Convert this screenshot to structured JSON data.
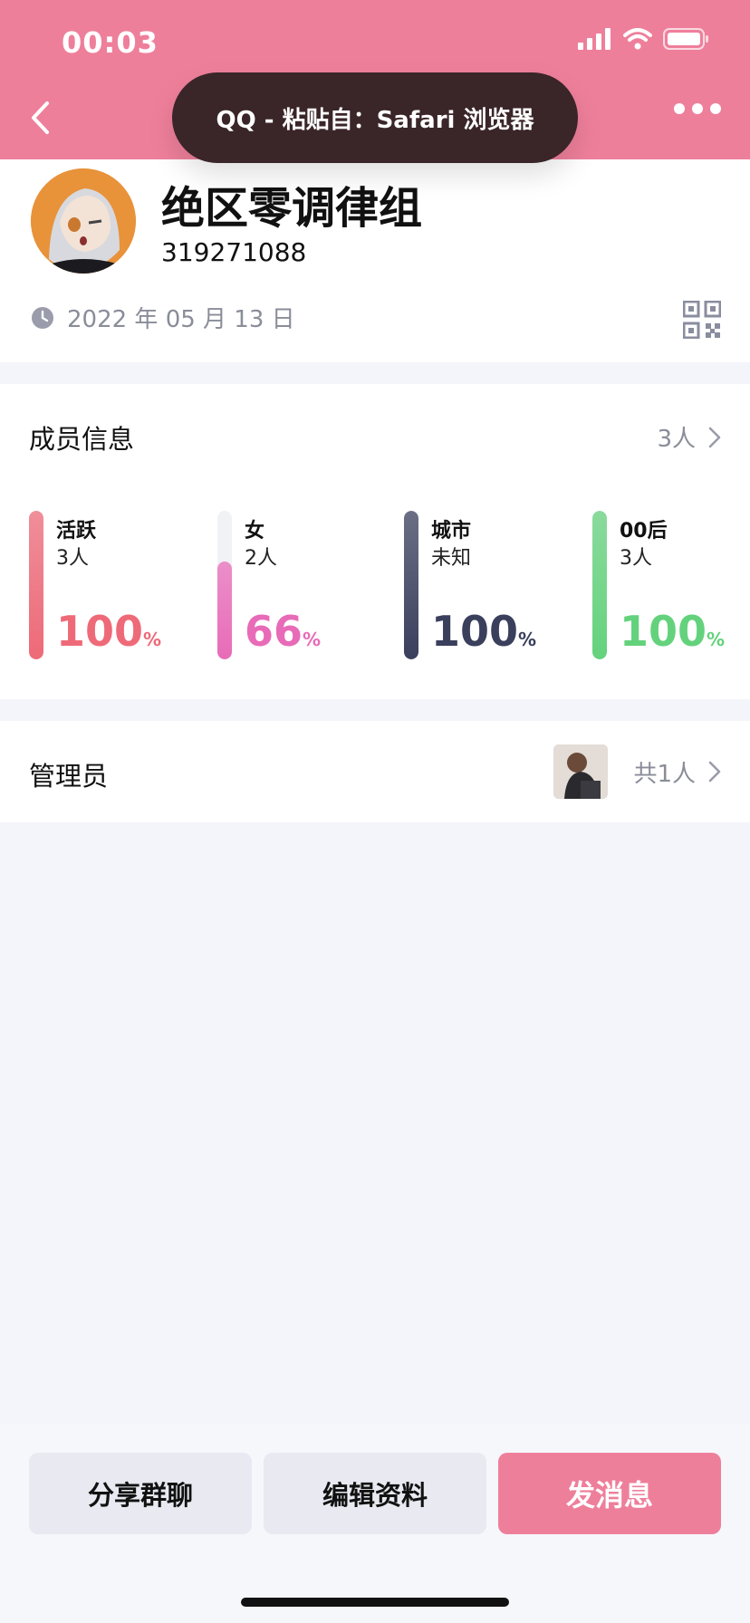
{
  "status_bar": {
    "time": "00:03"
  },
  "toast": {
    "text": "QQ - 粘贴自：Safari 浏览器"
  },
  "profile": {
    "name": "绝区零调律组",
    "id": "319271088",
    "date": "2022 年 05 月 13 日"
  },
  "members": {
    "title": "成员信息",
    "count": "3人",
    "stats": [
      {
        "label": "活跃",
        "sub": "3人",
        "percent": "100",
        "unit": "%",
        "fill_fraction": 1.0,
        "color": "#ee6a78"
      },
      {
        "label": "女",
        "sub": "2人",
        "percent": "66",
        "unit": "%",
        "fill_fraction": 0.66,
        "color": "#e86bb8"
      },
      {
        "label": "城市",
        "sub": "未知",
        "percent": "100",
        "unit": "%",
        "fill_fraction": 1.0,
        "color": "#3a3f5c"
      },
      {
        "label": "00后",
        "sub": "3人",
        "percent": "100",
        "unit": "%",
        "fill_fraction": 1.0,
        "color": "#64d27c"
      }
    ]
  },
  "admin": {
    "title": "管理员",
    "count": "共1人"
  },
  "actions": {
    "share": "分享群聊",
    "edit": "编辑资料",
    "message": "发消息"
  },
  "colors": {
    "accent": "#ee7f9b",
    "toast_bg": "#3a2528",
    "page_bg": "#f4f5fa"
  }
}
